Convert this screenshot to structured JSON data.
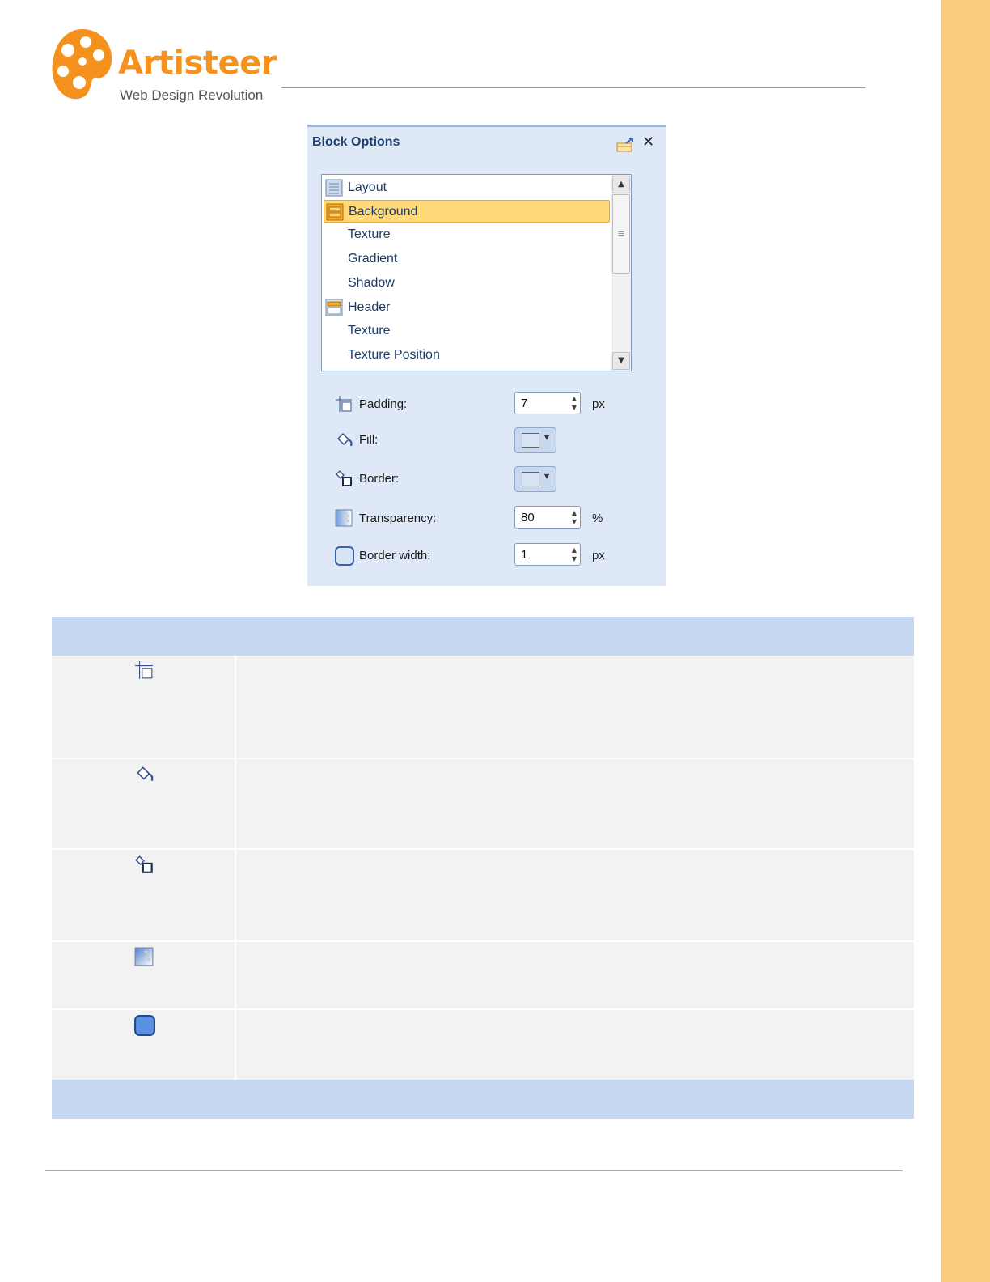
{
  "brand": {
    "title": "Artisteer",
    "tagline": "Web Design Revolution",
    "color": "#f5921e"
  },
  "panel": {
    "title": "Block Options",
    "close_glyph": "✕",
    "list_items": [
      {
        "label": "Layout",
        "icon": "layout-icon",
        "selected": false
      },
      {
        "label": "Background",
        "icon": "background-icon",
        "selected": true
      },
      {
        "label": "Texture",
        "icon": "",
        "selected": false
      },
      {
        "label": "Gradient",
        "icon": "",
        "selected": false
      },
      {
        "label": "Shadow",
        "icon": "",
        "selected": false
      },
      {
        "label": "Header",
        "icon": "header-icon",
        "selected": false
      },
      {
        "label": "Texture",
        "icon": "",
        "selected": false
      },
      {
        "label": "Texture Position",
        "icon": "",
        "selected": false
      }
    ],
    "properties": {
      "padding": {
        "label": "Padding:",
        "value": "7",
        "unit": "px"
      },
      "fill": {
        "label": "Fill:"
      },
      "border": {
        "label": "Border:"
      },
      "transparency": {
        "label": "Transparency:",
        "value": "80",
        "unit": "%"
      },
      "border_width": {
        "label": "Border width:",
        "value": "1",
        "unit": "px"
      }
    }
  },
  "table": {
    "row_icons": [
      "padding-icon",
      "fill-icon",
      "border-icon",
      "transparency-icon",
      "border-width-icon"
    ]
  },
  "colors": {
    "sidebar": "#f8cc7c",
    "table_header": "#c6d9f0",
    "table_row": "#f2f2f2",
    "selection": "#ffd97a"
  }
}
